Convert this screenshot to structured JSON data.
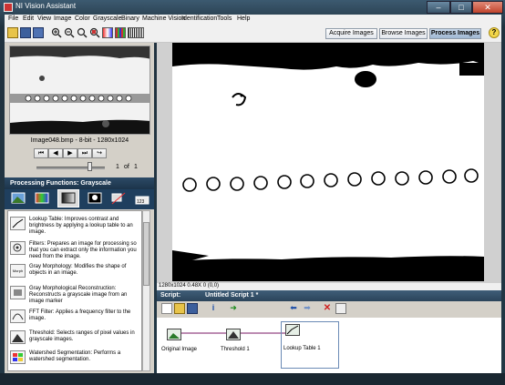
{
  "window": {
    "title": "NI Vision Assistant",
    "min": "–",
    "max": "□",
    "close": "✕"
  },
  "menu": [
    "File",
    "Edit",
    "View",
    "Image",
    "Color",
    "Grayscale",
    "Binary",
    "Machine Vision",
    "Identification",
    "Tools",
    "Help"
  ],
  "toolbar": {
    "acquire_label": "Acquire Images",
    "browse_label": "Browse Images",
    "process_label": "Process Images",
    "help_label": "?"
  },
  "browser": {
    "caption": "Image048.bmp - 8-bit - 1280x1024",
    "nav": [
      "⏮",
      "◀",
      "▶",
      "⏭",
      "↪"
    ],
    "page_current": "1",
    "page_of": "of",
    "page_total": "1"
  },
  "processing": {
    "header": "Processing Functions: Grayscale",
    "tabs": [
      "image-tab",
      "color-tab",
      "grayscale-tab",
      "binary-tab",
      "machine-vision-tab",
      "identification-tab"
    ],
    "functions": [
      {
        "icon": "lookup-table-icon",
        "label": "Lookup Table:  Improves contrast and brightness by applying a lookup table to an image."
      },
      {
        "icon": "filters-icon",
        "label": "Filters:  Prepares an image for processing so that you can extract only the information you need from the image."
      },
      {
        "icon": "gray-morphology-icon",
        "icon_text": "Morph",
        "label": "Gray Morphology:  Modifies the shape of objects in an image."
      },
      {
        "icon": "reconstruction-icon",
        "label": "Gray Morphological Reconstruction: Reconstructs a grayscale image from an image marker"
      },
      {
        "icon": "fft-filter-icon",
        "label": "FFT Filter:  Applies a frequency filter to the image."
      },
      {
        "icon": "threshold-icon",
        "label": "Threshold:  Selects ranges of pixel values in grayscale images."
      },
      {
        "icon": "watershed-icon",
        "label": "Watershed Segmentation:  Performs a watershed segmentation."
      }
    ]
  },
  "image_status": "1280x1024 0.48X 0    (0,0)",
  "script": {
    "label": "Script:",
    "name": "Untitled Script 1 *",
    "steps": [
      {
        "label": "Original Image"
      },
      {
        "label": "Threshold 1"
      },
      {
        "label": "Lookup Table 1"
      }
    ]
  }
}
